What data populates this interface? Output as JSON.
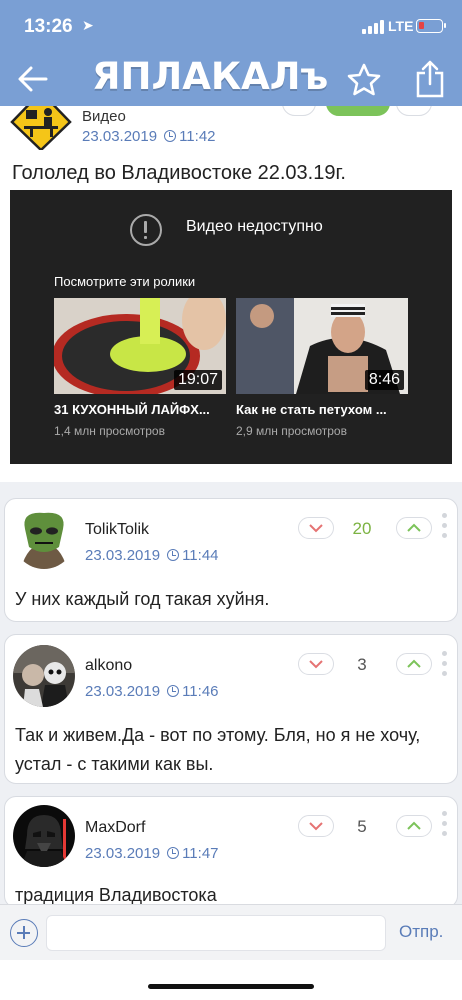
{
  "status_bar": {
    "time": "13:26",
    "network": "LTE"
  },
  "header": {
    "logo": "ЯПЛАКАЛъ"
  },
  "post": {
    "category": "Видео",
    "date": "23.03.2019",
    "time": "11:42",
    "title": "Гололед во Владивостоке 22.03.19г.",
    "video": {
      "unavailable_text": "Видео недоступно",
      "suggest_text": "Посмотрите эти ролики",
      "items": [
        {
          "title": "31 КУХОННЫЙ ЛАЙФХ...",
          "duration": "19:07",
          "views": "1,4 млн просмотров"
        },
        {
          "title": "Как не стать петухом ...",
          "duration": "8:46",
          "views": "2,9 млн просмотров"
        }
      ]
    }
  },
  "comments": [
    {
      "user": "TolikTolik",
      "date": "23.03.2019",
      "time": "11:44",
      "score": "20",
      "score_color": "#7cb342",
      "text": "У них каждый год такая хуйня."
    },
    {
      "user": "alkono",
      "date": "23.03.2019",
      "time": "11:46",
      "score": "3",
      "score_color": "#555555",
      "text": "Так и живем.Да - вот по этому. Бля, но я не хочу, устал - с такими как вы."
    },
    {
      "user": "MaxDorf",
      "date": "23.03.2019",
      "time": "11:47",
      "score": "5",
      "score_color": "#555555",
      "text": "традиция Владивостока"
    }
  ],
  "input": {
    "placeholder": "",
    "send_label": "Отпр."
  },
  "colors": {
    "header": "#7a9fd4",
    "link": "#5a7cb8",
    "upvote": "#7cc35a",
    "downvote": "#e57373"
  }
}
